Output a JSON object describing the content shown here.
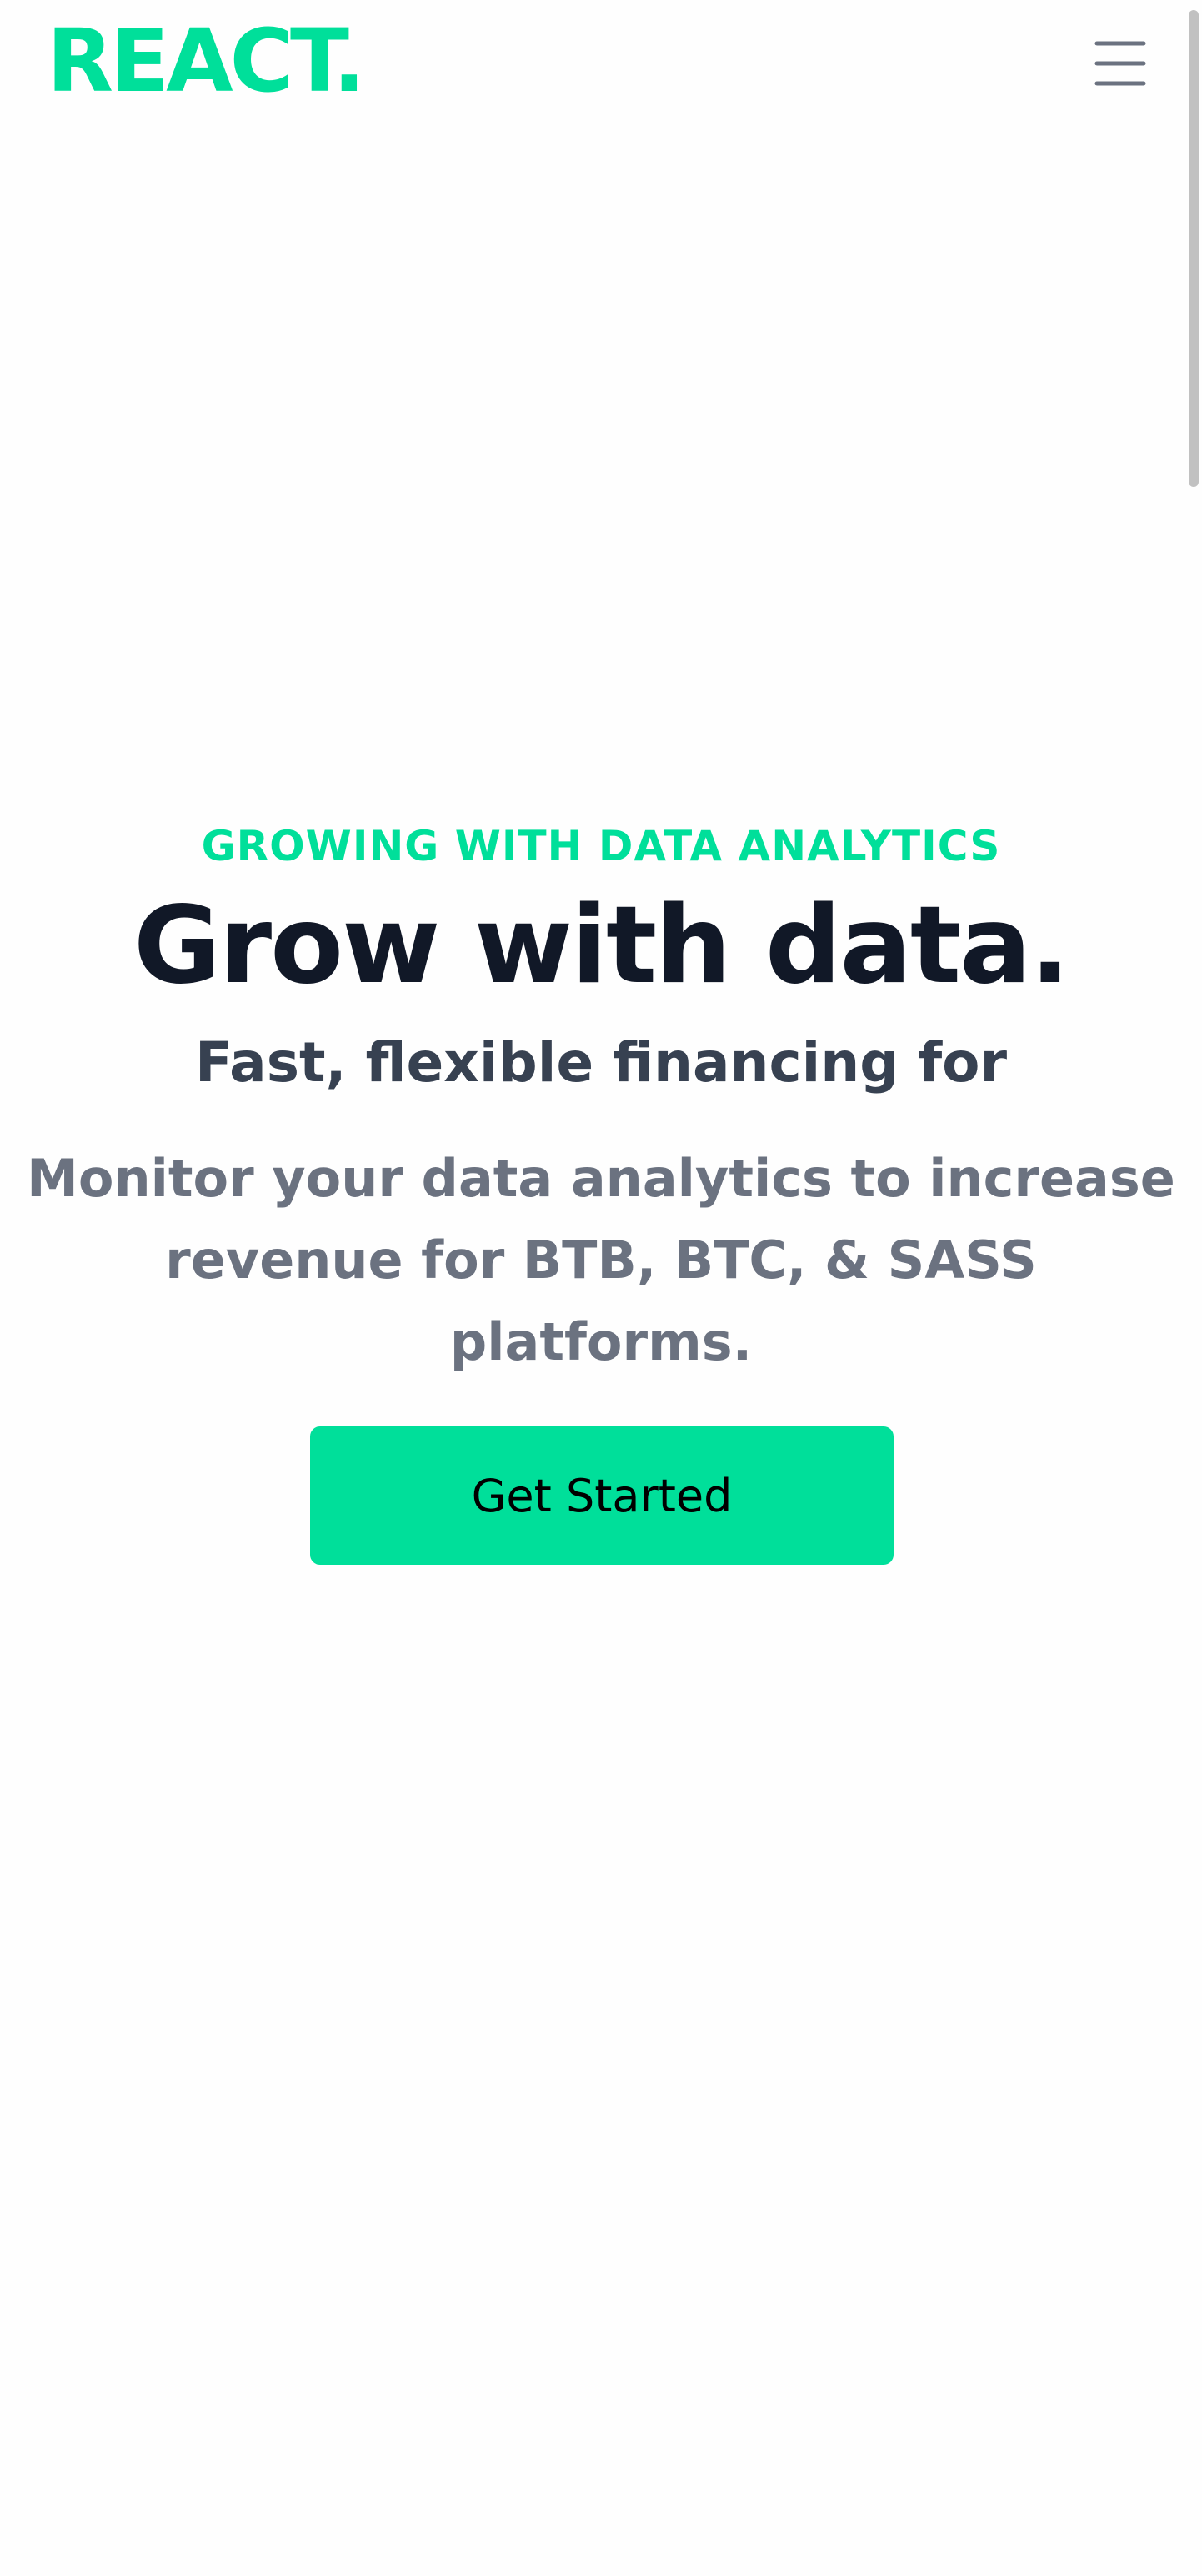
{
  "header": {
    "logo_text": "REACT.",
    "menu_icon": "hamburger-menu-icon"
  },
  "hero": {
    "eyebrow": "GROWING WITH DATA ANALYTICS",
    "headline": "Grow with data.",
    "subhead": "Fast, flexible financing for",
    "description": "Monitor your data analytics to increase revenue for BTB, BTC, & SASS platforms.",
    "cta_label": "Get Started"
  },
  "colors": {
    "accent": "#00df9a",
    "heading": "#111827",
    "subheading": "#374151",
    "body_text": "#6b7280",
    "background": "#fefefe"
  }
}
